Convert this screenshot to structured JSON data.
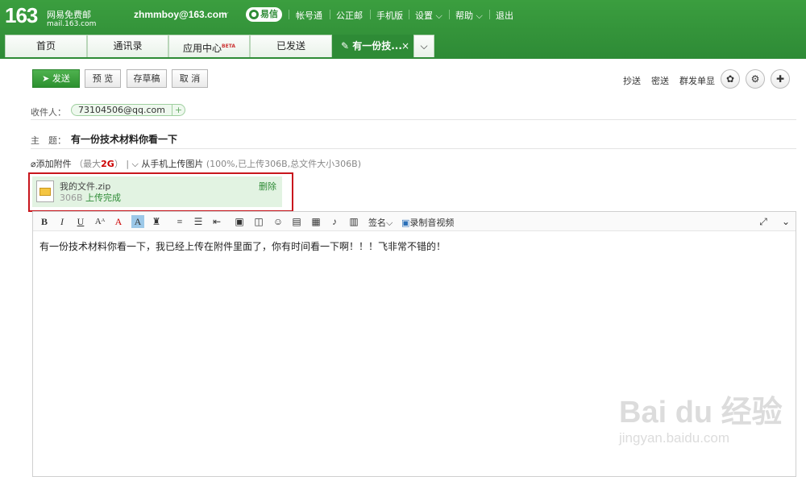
{
  "header": {
    "logo_number": "163",
    "logo_text": "网易免费邮",
    "logo_url": "mail.163.com",
    "account": "zhmmboy@163.com",
    "yixin": "易信",
    "nav": [
      "帐号通",
      "公正邮",
      "手机版",
      "设置",
      "帮助",
      "退出"
    ]
  },
  "tabs": [
    {
      "label": "首页"
    },
    {
      "label": "通讯录"
    },
    {
      "label": "应用中心",
      "badge": "BETA"
    },
    {
      "label": "已发送"
    },
    {
      "label": "有一份技...",
      "active": true
    }
  ],
  "toolbar": {
    "send": "发送",
    "preview": "预 览",
    "draft": "存草稿",
    "cancel": "取 消",
    "cc": "抄送",
    "bcc": "密送",
    "separate": "群发单显"
  },
  "compose": {
    "to_label": "收件人：",
    "recipient": "73104506@qq.com",
    "subject_label": "主　题：",
    "subject": "有一份技术材料你看一下",
    "add_attachment": "添加附件",
    "max_size_prefix": "（最大",
    "max_size": "2G",
    "max_size_suffix": "）",
    "phone_upload": "从手机上传图片",
    "upload_info": "(100%,已上传306B,总文件大小306B)"
  },
  "attachment": {
    "name": "我的文件.zip",
    "size": "306B",
    "status": "上传完成",
    "delete": "删除"
  },
  "editor": {
    "signature": "签名",
    "record_video": "录制音视频",
    "body": "有一份技术材料你看一下，我已经上传在附件里面了，你有时间看一下啊！！！飞非常不错的！"
  },
  "watermark": {
    "main": "Bai du 经验",
    "sub": "jingyan.baidu.com"
  },
  "colors": {
    "brand_green": "#2e8b36",
    "highlight_red": "#c8161d"
  }
}
